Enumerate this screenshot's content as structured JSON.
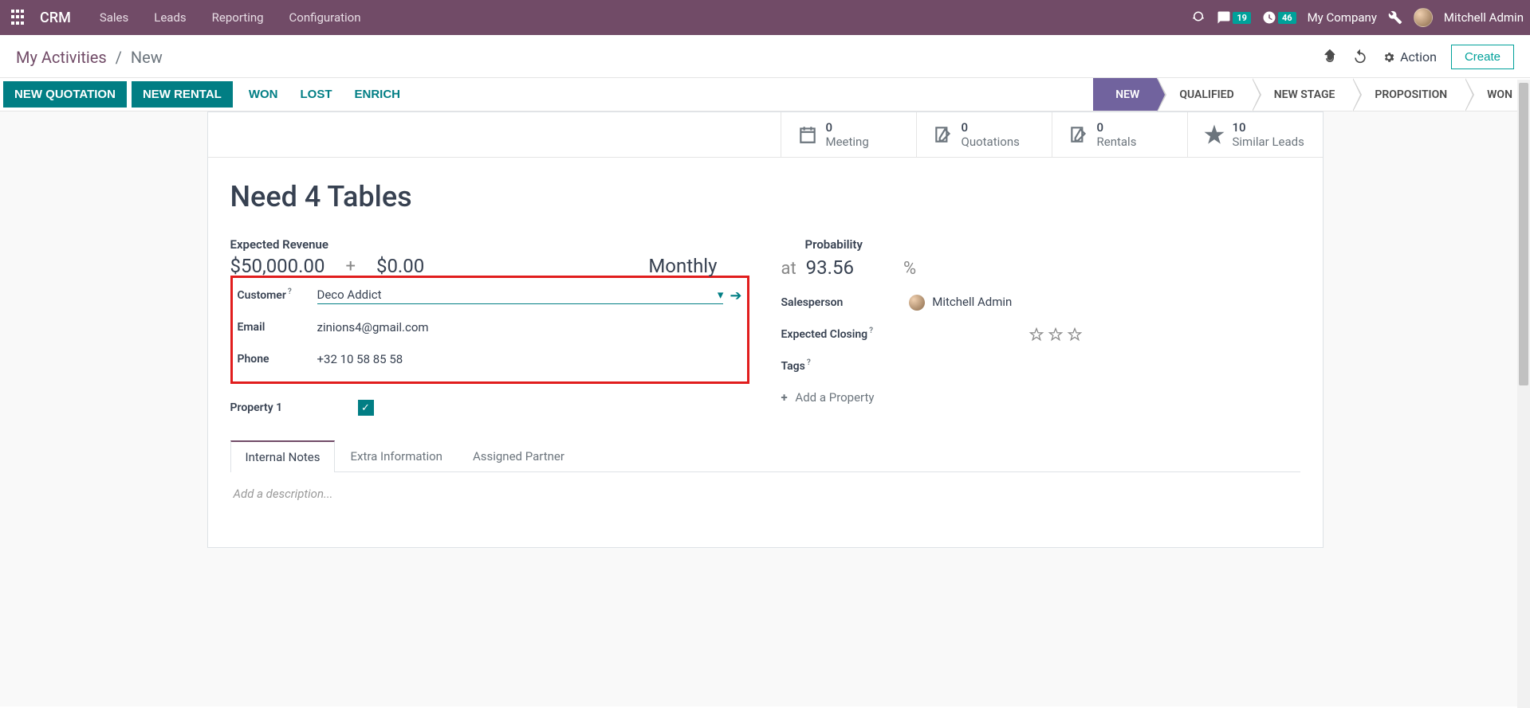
{
  "nav": {
    "brand": "CRM",
    "items": [
      "Sales",
      "Leads",
      "Reporting",
      "Configuration"
    ],
    "msg_badge": "19",
    "clock_badge": "46",
    "company": "My Company",
    "user": "Mitchell Admin"
  },
  "breadcrumb": {
    "link": "My Activities",
    "current": "New"
  },
  "cp": {
    "action_label": "Action",
    "create_label": "Create"
  },
  "actions": {
    "new_quotation": "NEW QUOTATION",
    "new_rental": "NEW RENTAL",
    "won": "WON",
    "lost": "LOST",
    "enrich": "ENRICH"
  },
  "stages": [
    "NEW",
    "QUALIFIED",
    "NEW STAGE",
    "PROPOSITION",
    "WON"
  ],
  "stats": {
    "meeting": {
      "count": "0",
      "label": "Meeting"
    },
    "quotations": {
      "count": "0",
      "label": "Quotations"
    },
    "rentals": {
      "count": "0",
      "label": "Rentals"
    },
    "similar": {
      "count": "10",
      "label": "Similar Leads"
    }
  },
  "record": {
    "title": "Need 4 Tables",
    "expected_revenue_label": "Expected Revenue",
    "revenue": "$50,000.00",
    "revenue_plus": "+",
    "revenue_recurring": "$0.00",
    "revenue_period": "Monthly",
    "customer_label": "Customer",
    "customer_value": "Deco Addict",
    "email_label": "Email",
    "email_value": "zinions4@gmail.com",
    "phone_label": "Phone",
    "phone_value": "+32 10 58 85 58",
    "property1_label": "Property 1",
    "probability_label": "Probability",
    "prob_at": "at",
    "prob_value": "93.56",
    "prob_pct": "%",
    "salesperson_label": "Salesperson",
    "salesperson_value": "Mitchell Admin",
    "closing_label": "Expected Closing",
    "tags_label": "Tags",
    "add_property": "Add a Property"
  },
  "tabs": [
    "Internal Notes",
    "Extra Information",
    "Assigned Partner"
  ],
  "description_placeholder": "Add a description..."
}
